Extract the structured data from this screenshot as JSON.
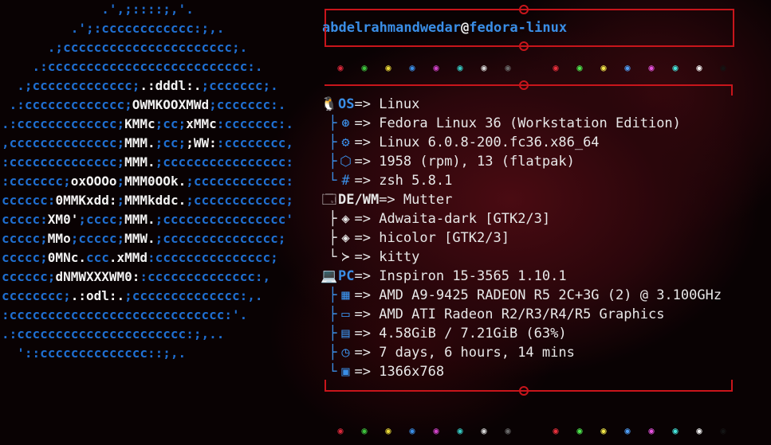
{
  "logo": {
    "lines": [
      [
        [
          "             .',;::::;,'.",
          ""
        ]
      ],
      [
        [
          "         .';:cccccccccccc:;,.",
          ""
        ]
      ],
      [
        [
          "      .;cccccccccccccccccccccc;.",
          ""
        ]
      ],
      [
        [
          "    .:cccccccccccccccccccccccccc:.",
          ""
        ]
      ],
      [
        [
          "  .;ccccccccccccc;",
          ""
        ],
        [
          ".:dddl:.",
          "w"
        ],
        [
          ";ccccccc;.",
          ""
        ]
      ],
      [
        [
          " .:ccccccccccccc;",
          ""
        ],
        [
          "OWMKOOXMWd",
          "w"
        ],
        [
          ";ccccccc:.",
          ""
        ]
      ],
      [
        [
          ".:ccccccccccccc;",
          ""
        ],
        [
          "KMMc",
          "w"
        ],
        [
          ";cc;",
          ""
        ],
        [
          "xMMc",
          "w"
        ],
        [
          ":ccccccc:.",
          ""
        ]
      ],
      [
        [
          ",cccccccccccccc;",
          ""
        ],
        [
          "MMM.",
          "w"
        ],
        [
          ";cc;",
          ""
        ],
        [
          ";WW:",
          "w"
        ],
        [
          ":cccccccc,",
          ""
        ]
      ],
      [
        [
          ":cccccccccccccc;",
          ""
        ],
        [
          "MMM.",
          "w"
        ],
        [
          ";cccccccccccccccc:",
          ""
        ]
      ],
      [
        [
          ":ccccccc;",
          ""
        ],
        [
          "oxOOOo",
          "w"
        ],
        [
          ";",
          ""
        ],
        [
          "MMM0OOk.",
          "w"
        ],
        [
          ";cccccccccccc:",
          ""
        ]
      ],
      [
        [
          "cccccc:",
          ""
        ],
        [
          "0MMKxdd:",
          "w"
        ],
        [
          ";",
          ""
        ],
        [
          "MMMkddc.",
          "w"
        ],
        [
          ";cccccccccccc;",
          ""
        ]
      ],
      [
        [
          "ccccc:",
          ""
        ],
        [
          "XM0'",
          "w"
        ],
        [
          ";cccc;",
          ""
        ],
        [
          "MMM.",
          "w"
        ],
        [
          ";cccccccccccccccc'",
          ""
        ]
      ],
      [
        [
          "ccccc;",
          ""
        ],
        [
          "MMo",
          "w"
        ],
        [
          ";ccccc;",
          ""
        ],
        [
          "MMW.",
          "w"
        ],
        [
          ";ccccccccccccccc;",
          ""
        ]
      ],
      [
        [
          "ccccc;",
          ""
        ],
        [
          "0MNc.",
          "w"
        ],
        [
          "ccc",
          ""
        ],
        [
          ".xMMd",
          "w"
        ],
        [
          ":ccccccccccccccc;",
          ""
        ]
      ],
      [
        [
          "cccccc;",
          ""
        ],
        [
          "dNMWXXXWM0:",
          "w"
        ],
        [
          ":cccccccccccccc:,",
          ""
        ]
      ],
      [
        [
          "cccccccc;",
          ""
        ],
        [
          ".:odl:.",
          "w"
        ],
        [
          ";cccccccccccccc:,.",
          ""
        ]
      ],
      [
        [
          ":cccccccccccccccccccccccccccc:'.",
          ""
        ]
      ],
      [
        [
          ".:cccccccccccccccccccccc:;,..",
          ""
        ]
      ],
      [
        [
          "  '::cccccccccccccc::;,.",
          ""
        ]
      ]
    ]
  },
  "prompt": {
    "user": "abdelrahmandwedar",
    "at": "@",
    "host": "fedora-linux"
  },
  "dot_colors": [
    "#d8283a",
    "#3ec43e",
    "#e8d838",
    "#3a8ee6",
    "#cf43c8",
    "#35c9c2",
    "#d6d6d6",
    "#6a6a6a",
    "",
    "#e8303c",
    "#4ee84e",
    "#f2e84a",
    "#4f9ef6",
    "#e653e0",
    "#45e5dc",
    "#f2f2f2",
    "#141414"
  ],
  "dot_glyph": "◉",
  "info": {
    "os": {
      "icon": "🐧",
      "key": "OS",
      "sep": "=> ",
      "value": "Linux"
    },
    "os_items": [
      {
        "icon": "⊛",
        "text": "=> Fedora Linux 36 (Workstation Edition)"
      },
      {
        "icon": "⚙",
        "text": "=> Linux 6.0.8-200.fc36.x86_64"
      },
      {
        "icon": "⬡",
        "text": "=> 1958 (rpm), 13 (flatpak)"
      },
      {
        "icon": "#",
        "text": "=> zsh 5.8.1"
      }
    ],
    "de": {
      "icon": "🗔",
      "key": "DE/WM",
      "sep": "=> ",
      "value": "Mutter"
    },
    "de_items": [
      {
        "icon": "◈",
        "text": "=> Adwaita-dark [GTK2/3]"
      },
      {
        "icon": "◈",
        "text": "=> hicolor [GTK2/3]"
      },
      {
        "icon": "≻",
        "text": "=> kitty"
      }
    ],
    "pc": {
      "icon": "💻",
      "key": "PC",
      "sep": "=> ",
      "value": "Inspiron 15-3565 1.10.1"
    },
    "pc_items": [
      {
        "icon": "▦",
        "text": "=> AMD A9-9425 RADEON R5 2C+3G (2) @ 3.100GHz"
      },
      {
        "icon": "▭",
        "text": "=> AMD ATI Radeon R2/R3/R4/R5 Graphics"
      },
      {
        "icon": "▤",
        "text": "=> 4.58GiB / 7.21GiB (63%)"
      },
      {
        "icon": "◷",
        "text": "=> 7 days, 6 hours, 14 mins"
      },
      {
        "icon": "▣",
        "text": "=> 1366x768"
      }
    ],
    "tree": {
      "branch": "├",
      "last": "└",
      "vert": "│"
    }
  }
}
